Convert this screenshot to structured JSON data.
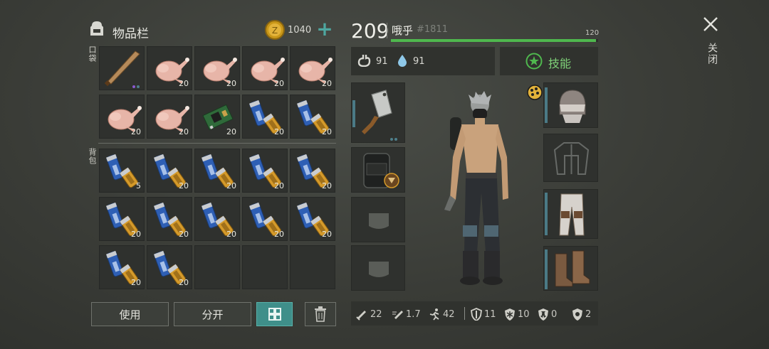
{
  "inventory": {
    "title": "物品栏",
    "coins": "1040",
    "pocket_label": "口袋",
    "backpack_label": "背包",
    "pocket_slots": [
      {
        "item": "bat",
        "count": ""
      },
      {
        "item": "chicken",
        "count": "20"
      },
      {
        "item": "chicken",
        "count": "20"
      },
      {
        "item": "chicken",
        "count": "20"
      },
      {
        "item": "chicken",
        "count": "20"
      },
      {
        "item": "chicken",
        "count": "20"
      },
      {
        "item": "chicken",
        "count": "20"
      },
      {
        "item": "circuit",
        "count": "20"
      },
      {
        "item": "battery",
        "count": "20"
      },
      {
        "item": "battery",
        "count": "20"
      }
    ],
    "backpack_slots": [
      {
        "item": "battery",
        "count": "5"
      },
      {
        "item": "battery",
        "count": "20"
      },
      {
        "item": "battery",
        "count": "20"
      },
      {
        "item": "battery",
        "count": "20"
      },
      {
        "item": "battery",
        "count": "20"
      },
      {
        "item": "battery",
        "count": "20"
      },
      {
        "item": "battery",
        "count": "20"
      },
      {
        "item": "battery",
        "count": "20"
      },
      {
        "item": "battery",
        "count": "20"
      },
      {
        "item": "battery",
        "count": "20"
      },
      {
        "item": "battery",
        "count": "20"
      },
      {
        "item": "battery",
        "count": "20"
      },
      {
        "item": "",
        "count": ""
      },
      {
        "item": "",
        "count": ""
      },
      {
        "item": "",
        "count": ""
      }
    ],
    "use_label": "使用",
    "split_label": "分开"
  },
  "character": {
    "level": "209",
    "name": "哦乎",
    "tag": "#1811",
    "xp_max": "120",
    "xp_fraction": 0.99,
    "food": "91",
    "water": "91",
    "skills_label": "技能"
  },
  "stats": [
    {
      "icon": "sword-icon",
      "value": "22"
    },
    {
      "icon": "attack-speed-icon",
      "value": "1.7"
    },
    {
      "icon": "run-icon",
      "value": "42"
    },
    {
      "icon": "shield-icon",
      "value": "11"
    },
    {
      "icon": "frost-icon",
      "value": "10"
    },
    {
      "icon": "radiation-icon",
      "value": "0"
    },
    {
      "icon": "gear-shield-icon",
      "value": "2"
    }
  ],
  "close_label": "关闭",
  "colors": {
    "accent": "#4ea7a0",
    "xp": "#4fb84e",
    "battery_blue": "#2e5fb5",
    "battery_gold": "#d59a2a"
  }
}
